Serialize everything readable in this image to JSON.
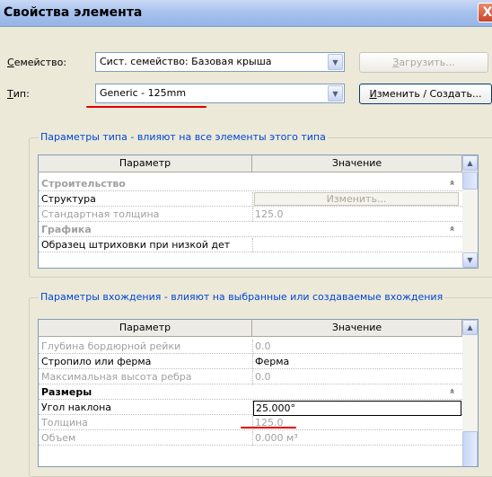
{
  "window": {
    "title": "Свойства элемента",
    "close": "X"
  },
  "family": {
    "label_first": "С",
    "label_rest": "емейство:",
    "value": "Сист. семейство: Базовая крыша"
  },
  "load_button": {
    "first": "З",
    "rest": "агрузить..."
  },
  "type": {
    "label_first": "Т",
    "label_rest": "ип:",
    "value": "Generic - 125mm"
  },
  "edit_new_button": {
    "first": "И",
    "rest": "зменить / Создать..."
  },
  "type_params": {
    "legend": "Параметры типа - влияют на все элементы этого типа",
    "col_param": "Параметр",
    "col_value": "Значение",
    "rows": [
      {
        "name": "Строительство",
        "value": "",
        "kind": "group",
        "disabled": true
      },
      {
        "name": "Структура",
        "value": "Изменить...",
        "kind": "button",
        "disabled": false
      },
      {
        "name": "Стандартная толщина",
        "value": "125.0",
        "kind": "value",
        "disabled": true
      },
      {
        "name": "Графика",
        "value": "",
        "kind": "group",
        "disabled": true
      },
      {
        "name": "Образец штриховки при низкой дет",
        "value": "",
        "kind": "value",
        "disabled": false
      }
    ]
  },
  "instance_params": {
    "legend": "Параметры вхождения - влияют на выбранные или создаваемые вхождения",
    "col_param": "Параметр",
    "col_value": "Значение",
    "rows": [
      {
        "name": "Глубина бордюрной рейки",
        "value": "0.0",
        "kind": "value",
        "disabled": true
      },
      {
        "name": "Стропило или ферма",
        "value": "Ферма",
        "kind": "value",
        "disabled": false
      },
      {
        "name": "Максимальная высота ребра",
        "value": "0.0",
        "kind": "value",
        "disabled": true
      },
      {
        "name": "Размеры",
        "value": "",
        "kind": "group",
        "disabled": false
      },
      {
        "name": "Угол наклона",
        "value": "25.000°",
        "kind": "edit",
        "disabled": false
      },
      {
        "name": "Толщина",
        "value": "125.0",
        "kind": "value",
        "disabled": true
      },
      {
        "name": "Объем",
        "value": "0.000 м³",
        "kind": "value",
        "disabled": true
      }
    ]
  },
  "icons": {
    "collapse": "chevron-up-double-icon",
    "dropdown": "chevron-down-icon"
  },
  "colors": {
    "annotation": "#e00000",
    "legend_text": "#0046d5"
  }
}
